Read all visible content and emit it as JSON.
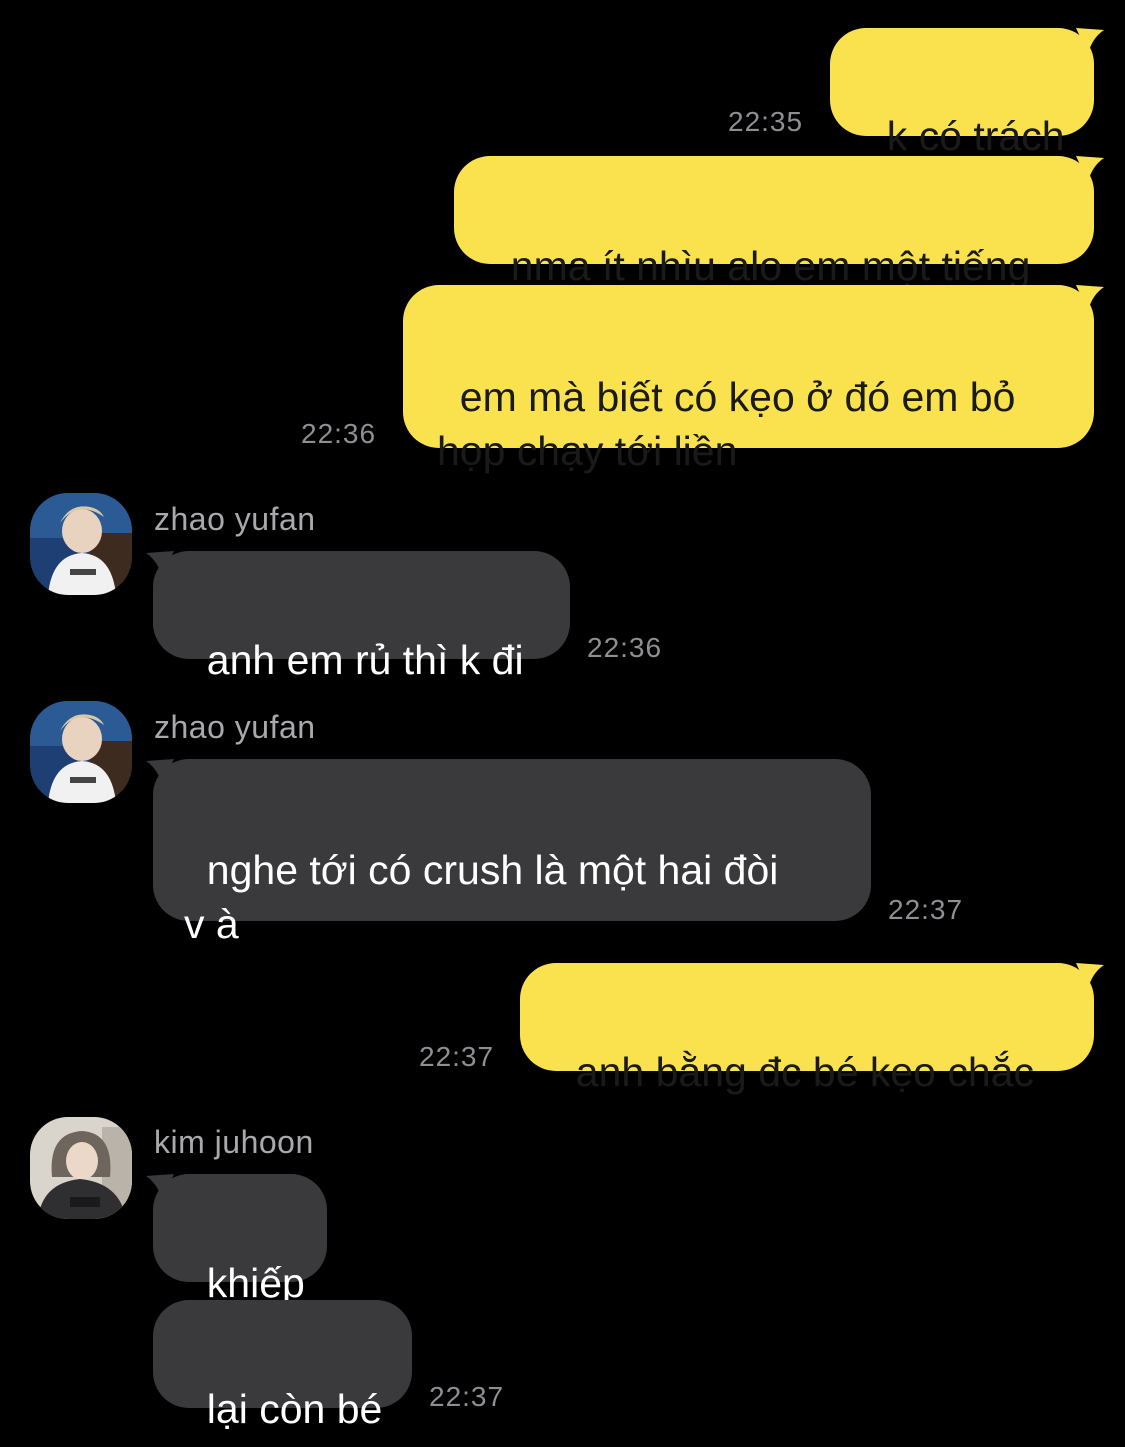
{
  "messages": [
    {
      "id": "m1",
      "direction": "outgoing",
      "text": "k có trách",
      "time": "22:35"
    },
    {
      "id": "m2",
      "direction": "outgoing",
      "text": "nma ít nhìu alo em một tiếng",
      "time": ""
    },
    {
      "id": "m3",
      "direction": "outgoing",
      "text": "em mà biết có kẹo ở đó em bỏ\nhọp chạy tới liền",
      "time": "22:36"
    },
    {
      "id": "m4",
      "direction": "incoming",
      "sender": "zhao yufan",
      "avatar": "avatar-zhao-yufan",
      "text": "anh em rủ thì k đi",
      "time": "22:36"
    },
    {
      "id": "m5",
      "direction": "incoming",
      "sender": "zhao yufan",
      "avatar": "avatar-zhao-yufan",
      "text": "nghe tới có crush là một hai đòi\nv à",
      "time": "22:37"
    },
    {
      "id": "m6",
      "direction": "outgoing",
      "text": "anh bằng đc bé kẹo chắc",
      "time": "22:37"
    },
    {
      "id": "m7",
      "direction": "incoming",
      "sender": "kim juhoon",
      "avatar": "avatar-kim-juhoon",
      "text": "khiếp",
      "time": ""
    },
    {
      "id": "m8",
      "direction": "incoming",
      "text": "lại còn bé",
      "time": "22:37"
    }
  ],
  "colors": {
    "background": "#000000",
    "outgoing_bubble": "#f9e24d",
    "incoming_bubble": "#3a3a3c",
    "timestamp": "#8e8e93",
    "sender_name": "#a9a9ad"
  }
}
